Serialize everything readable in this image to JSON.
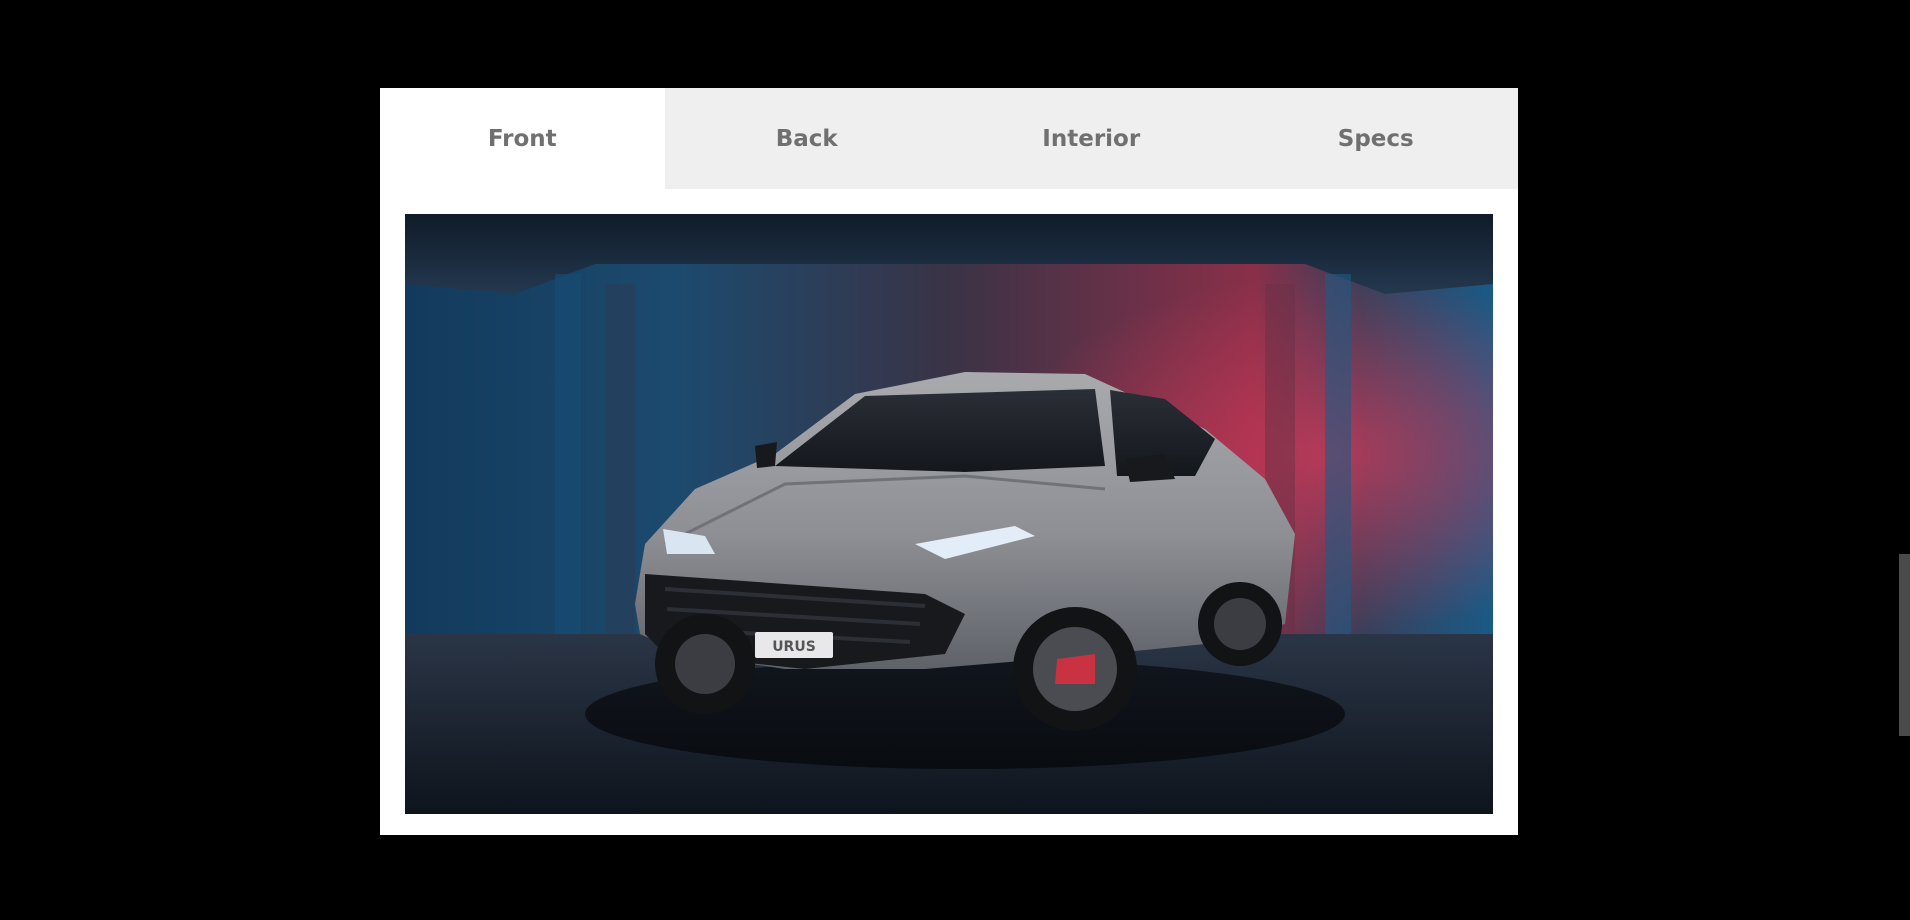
{
  "tabs": [
    {
      "label": "Front",
      "active": true
    },
    {
      "label": "Back",
      "active": false
    },
    {
      "label": "Interior",
      "active": false
    },
    {
      "label": "Specs",
      "active": false
    }
  ],
  "gallery": {
    "image_subject": "gray lamborghini suv front three-quarter view in studio",
    "plate_text": "URUS"
  },
  "colors": {
    "page_background": "#000000",
    "tab_bar": "#efefef",
    "active_tab": "#ffffff",
    "tab_text": "#707070"
  }
}
